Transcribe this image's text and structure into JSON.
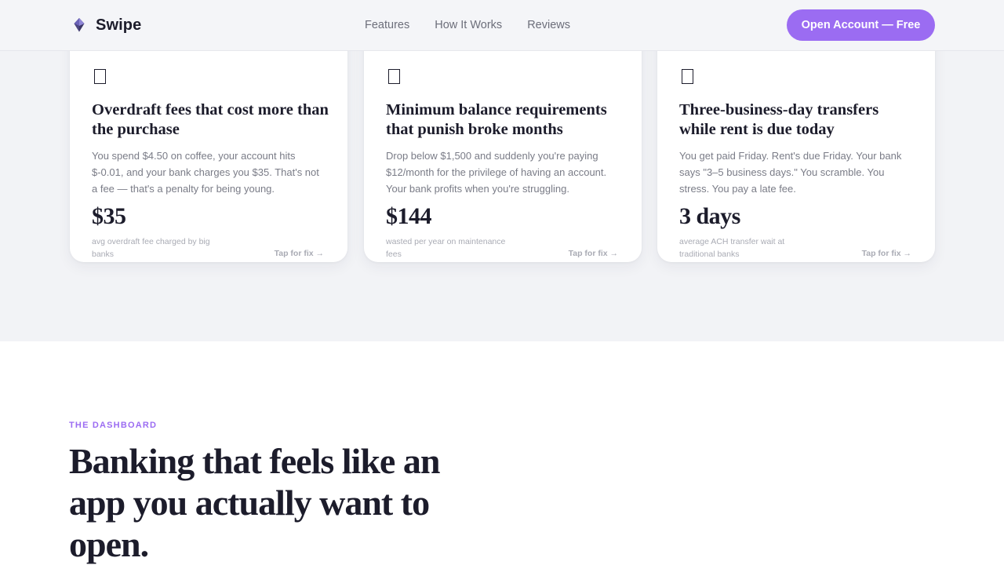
{
  "nav": {
    "brand": "Swipe",
    "links": [
      "Features",
      "How It Works",
      "Reviews"
    ],
    "cta": "Open Account — Free"
  },
  "cards": [
    {
      "icon": "empty-box-icon",
      "title": "Overdraft fees that cost more than the purchase",
      "description": "You spend $4.50 on coffee, your account hits $-0.01, and your bank charges you $35. That's not a fee — that's a penalty for being young.",
      "stat": "$35",
      "stat_label": "avg overdraft fee charged by big banks",
      "fix": "Tap for fix →"
    },
    {
      "icon": "empty-box-icon",
      "title": "Minimum balance requirements that punish broke months",
      "description": "Drop below $1,500 and suddenly you're paying $12/month for the privilege of having an account. Your bank profits when you're struggling.",
      "stat": "$144",
      "stat_label": "wasted per year on maintenance fees",
      "fix": "Tap for fix →"
    },
    {
      "icon": "empty-box-icon",
      "title": "Three-business-day transfers while rent is due today",
      "description": "You get paid Friday. Rent's due Friday. Your bank says \"3–5 business days.\" You scramble. You stress. You pay a late fee.",
      "stat": "3 days",
      "stat_label": "average ACH transfer wait at traditional banks",
      "fix": "Tap for fix →"
    }
  ],
  "dashboard": {
    "eyebrow": "THE DASHBOARD",
    "headline": "Banking that feels like an app you actually want to open."
  },
  "colors": {
    "accent": "#9b6cf2",
    "text": "#1c1c2b",
    "muted": "#7a7c87",
    "section_bg": "#f2f3f6"
  }
}
